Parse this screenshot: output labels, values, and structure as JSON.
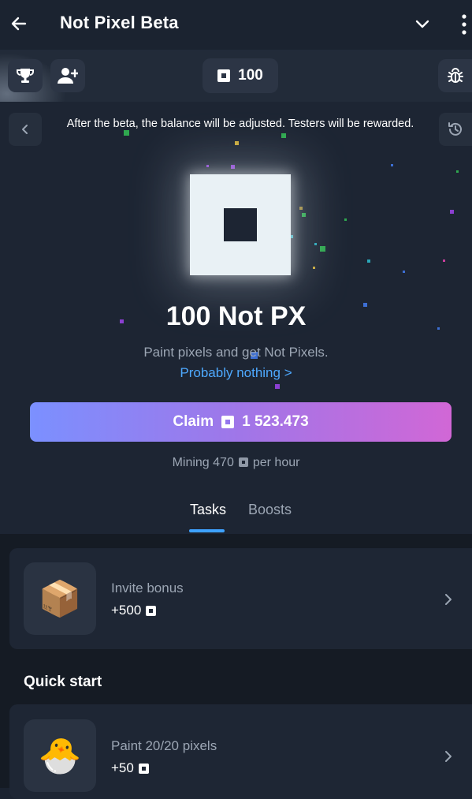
{
  "header": {
    "back_icon": "arrow-left-icon",
    "title": "Not Pixel Beta",
    "dropdown_icon": "chevron-down-icon",
    "menu_icon": "more-vertical-icon"
  },
  "toolbar": {
    "leaderboard_icon": "trophy-icon",
    "invite_icon": "add-user-icon",
    "balance": "100",
    "settings_icon": "bug-icon"
  },
  "notice": {
    "text": "After the beta, the balance will be adjusted. Testers will be rewarded."
  },
  "hero": {
    "amount": "100 Not PX",
    "subtitle": "Paint pixels and get Not Pixels.",
    "link": "Probably nothing >"
  },
  "claim": {
    "label": "Claim",
    "value": "1 523.473"
  },
  "mining": {
    "prefix": "Mining 470",
    "suffix": "per hour"
  },
  "tabs": [
    {
      "label": "Tasks",
      "active": true
    },
    {
      "label": "Boosts",
      "active": false
    }
  ],
  "tasks": {
    "invite": {
      "title": "Invite bonus",
      "reward": "+500",
      "emoji": "📦"
    },
    "section_heading": "Quick start",
    "paint": {
      "title": "Paint 20/20 pixels",
      "reward": "+50",
      "emoji": "🐣"
    }
  },
  "colors": {
    "background": "#1b2330",
    "accent_link": "#4ea9ff",
    "claim_gradient_start": "#7b90ff",
    "claim_gradient_end": "#d167d6",
    "tab_underline": "#3ea2ff"
  }
}
